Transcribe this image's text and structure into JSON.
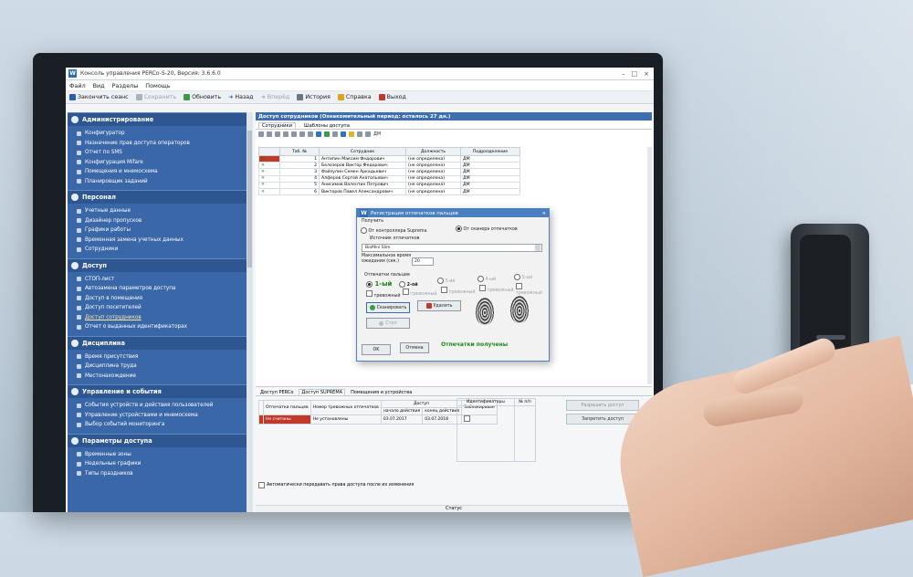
{
  "window": {
    "title": "Консоль управления PERCo-S-20, Версия: 3.6.6.0"
  },
  "menu": [
    "Файл",
    "Вид",
    "Разделы",
    "Помощь"
  ],
  "toolbar": {
    "end_session": "Закончить сеанс",
    "save": "Сохранить",
    "refresh": "Обновить",
    "back": "Назад",
    "forward": "Вперёд",
    "history": "История",
    "help": "Справка",
    "exit": "Выход"
  },
  "sidebar": {
    "sections": [
      {
        "title": "Администрирование",
        "items": [
          "Конфигуратор",
          "Назначение прав доступа операторов",
          "Отчет по SMS",
          "Конфигурация Mifare",
          "Помещения и мнемосхема",
          "Планировщик заданий"
        ]
      },
      {
        "title": "Персонал",
        "items": [
          "Учетные данные",
          "Дизайнер пропусков",
          "Графики работы",
          "Временная замена учетных данных",
          "Сотрудники"
        ]
      },
      {
        "title": "Доступ",
        "items": [
          "СТОП-лист",
          "Автозамена параметров доступа",
          "Доступ в помещения",
          "Доступ посетителей",
          "Доступ сотрудников",
          "Отчет о выданных идентификаторах"
        ]
      },
      {
        "title": "Дисциплина",
        "items": [
          "Время присутствия",
          "Дисциплина труда",
          "Местонахождение"
        ]
      },
      {
        "title": "Управление и события",
        "items": [
          "События устройств и действия пользователей",
          "Управление устройствами и мнемосхема",
          "Выбор событий мониторинга"
        ]
      },
      {
        "title": "Параметры доступа",
        "items": [
          "Временные зоны",
          "Недельные графики",
          "Типы праздников"
        ]
      }
    ]
  },
  "main": {
    "title": "Доступ сотрудников (Ознакомительный период: осталось 27 дн.)",
    "tabs": [
      "Сотрудники",
      "Шаблоны доступа"
    ],
    "dm_label": "ДМ",
    "table": {
      "headers": [
        "Таб. №",
        "Сотрудник",
        "Должность",
        "Подразделение"
      ],
      "rows": [
        {
          "num": "1",
          "name": "Антипин Максим Федорович",
          "position": "(не определена)",
          "dept": "ДМ"
        },
        {
          "num": "2",
          "name": "Белозеров Виктор Федорович",
          "position": "(не определена)",
          "dept": "ДМ"
        },
        {
          "num": "3",
          "name": "Файзулин Семен Аркадьевич",
          "position": "(не определена)",
          "dept": "ДМ"
        },
        {
          "num": "4",
          "name": "Алферов Сергей Анатольевич",
          "position": "(не определена)",
          "dept": "ДМ"
        },
        {
          "num": "5",
          "name": "Анисимов Валентин Петрович",
          "position": "(не определена)",
          "dept": "ДМ"
        },
        {
          "num": "6",
          "name": "Викторов Павел Александрович",
          "position": "(не определена)",
          "dept": "ДМ"
        }
      ]
    }
  },
  "lower": {
    "tabs": [
      "Доступ PERCo",
      "Доступ SUPREMA",
      "Помещения и устройства"
    ],
    "access_headers": [
      "Отпечатки пальцев",
      "Номер тревожных отпечатков",
      "начало действия",
      "конец действия",
      "Заблокирован"
    ],
    "access_group_header": "Доступ",
    "access_row": {
      "fp": "Не считаны",
      "alarm": "Не установлены",
      "start": "03.07.2017",
      "end": "03.07.2018"
    },
    "id_headers": [
      "Идентификаторы",
      "№ п/п"
    ],
    "btn_grant": "Разрешить доступ",
    "btn_deny": "Запретить доступ",
    "auto_transfer": "Автоматически передавать права доступа после их изменения",
    "status": "Статус"
  },
  "dialog": {
    "title": "Регистрация отпечатков пальцев",
    "receive_label": "Получить",
    "from_controller": "От контроллера Suprema",
    "from_scanner": "От сканера отпечатков",
    "source_label": "Источник отпечатков",
    "source_value": "BioMini Slim",
    "wait_label": "Максимальное время ожидания (сек.)",
    "wait_value": "20",
    "fingers_label": "Отпечатки пальцев",
    "finger1": "1-ый",
    "finger2": "2-ой",
    "finger3": "3-ий",
    "finger4": "4-ый",
    "finger5": "5-ый",
    "alarm": "тревожный",
    "scan_btn": "Сканировать",
    "delete_btn": "Удалить",
    "stop_btn": "Стоп",
    "ok_btn": "OK",
    "cancel_btn": "Отмена",
    "result": "Отпечатки получены"
  },
  "colors": {
    "sidebar": "#3a67a8",
    "section_header": "#2e5792",
    "accent": "#4a7fc0",
    "success": "#1a8a1a"
  }
}
